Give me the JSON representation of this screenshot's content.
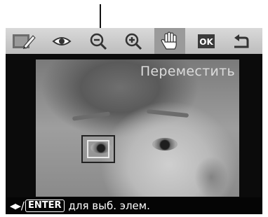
{
  "toolbar": {
    "items": [
      {
        "name": "edit-frame-icon",
        "selected": false
      },
      {
        "name": "red-eye-icon",
        "selected": false
      },
      {
        "name": "zoom-out-icon",
        "selected": false
      },
      {
        "name": "zoom-in-icon",
        "selected": false
      },
      {
        "name": "hand-move-icon",
        "selected": true
      },
      {
        "name": "ok-icon",
        "selected": false
      },
      {
        "name": "return-icon",
        "selected": false
      }
    ],
    "ok_label": "OK"
  },
  "screen": {
    "caption": "Переместить"
  },
  "status": {
    "arrows": "◀▶",
    "slash": "/",
    "enter_key": "ENTER",
    "hint": "для выб. элем."
  }
}
